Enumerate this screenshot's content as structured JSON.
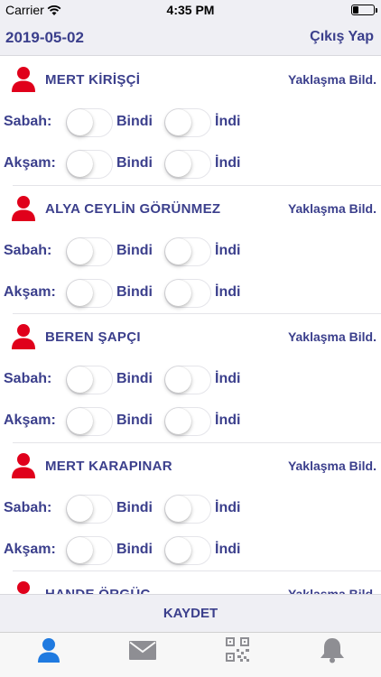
{
  "status_bar": {
    "carrier": "Carrier",
    "time": "4:35 PM",
    "battery_level": 0.25
  },
  "header": {
    "date": "2019-05-02",
    "logout_label": "Çıkış Yap"
  },
  "labels": {
    "morning": "Sabah:",
    "evening": "Akşam:",
    "boarded": "Bindi",
    "alighted": "İndi",
    "notify": "Yaklaşma Bild."
  },
  "students": [
    {
      "name": "MERT KİRİŞÇİ",
      "morning_boarded": false,
      "morning_alighted": false,
      "evening_boarded": false,
      "evening_alighted": false
    },
    {
      "name": "ALYA CEYLİN GÖRÜNMEZ",
      "morning_boarded": false,
      "morning_alighted": false,
      "evening_boarded": false,
      "evening_alighted": false
    },
    {
      "name": "BEREN ŞAPÇI",
      "morning_boarded": false,
      "morning_alighted": false,
      "evening_boarded": false,
      "evening_alighted": false
    },
    {
      "name": "MERT KARAPINAR",
      "morning_boarded": false,
      "morning_alighted": false,
      "evening_boarded": false,
      "evening_alighted": false
    },
    {
      "name": "HANDE ÖRGÜÇ",
      "morning_boarded": false,
      "morning_alighted": false,
      "evening_boarded": false,
      "evening_alighted": false
    }
  ],
  "save_label": "KAYDET",
  "tabs": [
    {
      "icon": "user-icon",
      "active": true
    },
    {
      "icon": "mail-icon",
      "active": false
    },
    {
      "icon": "qr-code-icon",
      "active": false
    },
    {
      "icon": "bell-icon",
      "active": false
    }
  ],
  "colors": {
    "accent": "#3b3f8c",
    "avatar": "#e0001b",
    "tab_active": "#1f7ae0",
    "tab_inactive": "#8e8e93"
  }
}
